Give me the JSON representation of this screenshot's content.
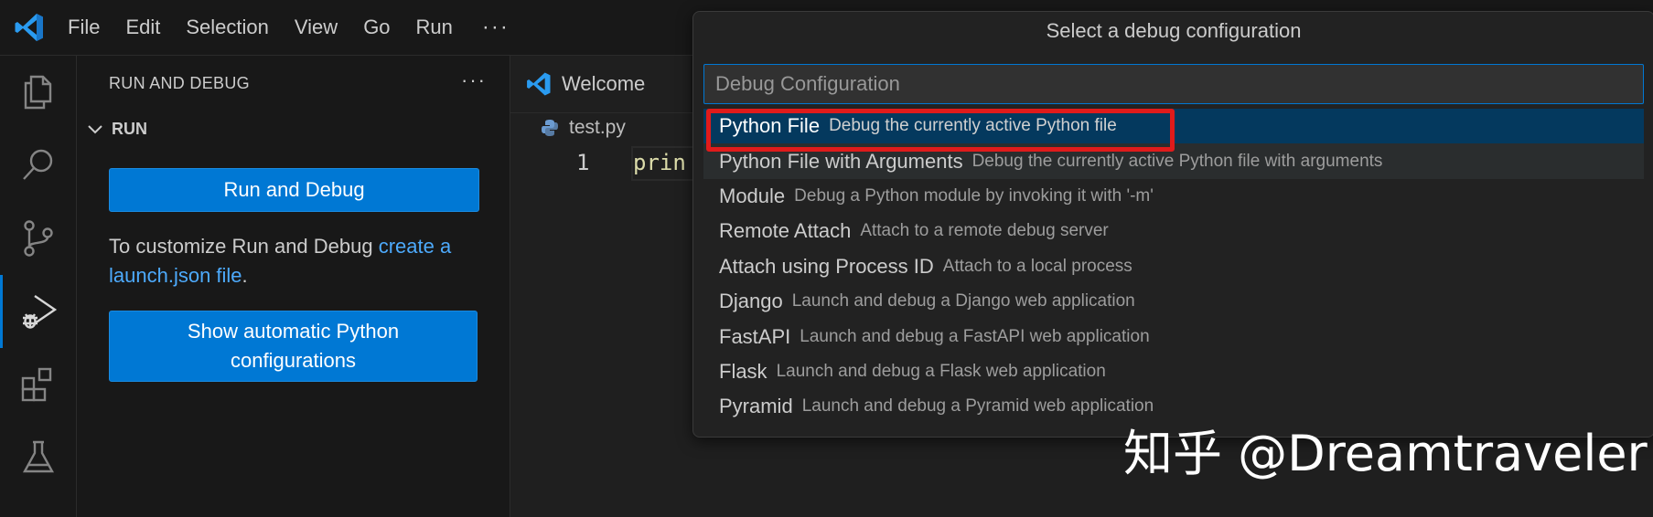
{
  "menu": {
    "items": [
      "File",
      "Edit",
      "Selection",
      "View",
      "Go",
      "Run"
    ],
    "more": "···"
  },
  "activity_bar": {
    "icons": [
      "explorer-icon",
      "search-icon",
      "source-control-icon",
      "run-debug-icon",
      "extensions-icon",
      "testing-icon"
    ],
    "active": "run-debug-icon",
    "accent": "#0078d4"
  },
  "sidebar": {
    "title": "RUN AND DEBUG",
    "more": "···",
    "section": "RUN",
    "run_button": "Run and Debug",
    "customize_text": "To customize Run and Debug ",
    "customize_link": "create a launch.json file",
    "customize_suffix": ".",
    "auto_button": "Show automatic Python configurations"
  },
  "editor": {
    "tab_label": "Welcome",
    "breadcrumb": "test.py",
    "line_number": "1",
    "code": "prin"
  },
  "quick_pick": {
    "title": "Select a debug configuration",
    "placeholder": "Debug Configuration",
    "items": [
      {
        "label": "Python File",
        "description": "Debug the currently active Python file"
      },
      {
        "label": "Python File with Arguments",
        "description": "Debug the currently active Python file with arguments"
      },
      {
        "label": "Module",
        "description": "Debug a Python module by invoking it with '-m'"
      },
      {
        "label": "Remote Attach",
        "description": "Attach to a remote debug server"
      },
      {
        "label": "Attach using Process ID",
        "description": "Attach to a local process"
      },
      {
        "label": "Django",
        "description": "Launch and debug a Django web application"
      },
      {
        "label": "FastAPI",
        "description": "Launch and debug a FastAPI web application"
      },
      {
        "label": "Flask",
        "description": "Launch and debug a Flask web application"
      },
      {
        "label": "Pyramid",
        "description": "Launch and debug a Pyramid web application"
      }
    ],
    "selected_index": 0,
    "highlight_color": "#e01b1b"
  },
  "watermark": "知乎 @Dreamtraveler"
}
